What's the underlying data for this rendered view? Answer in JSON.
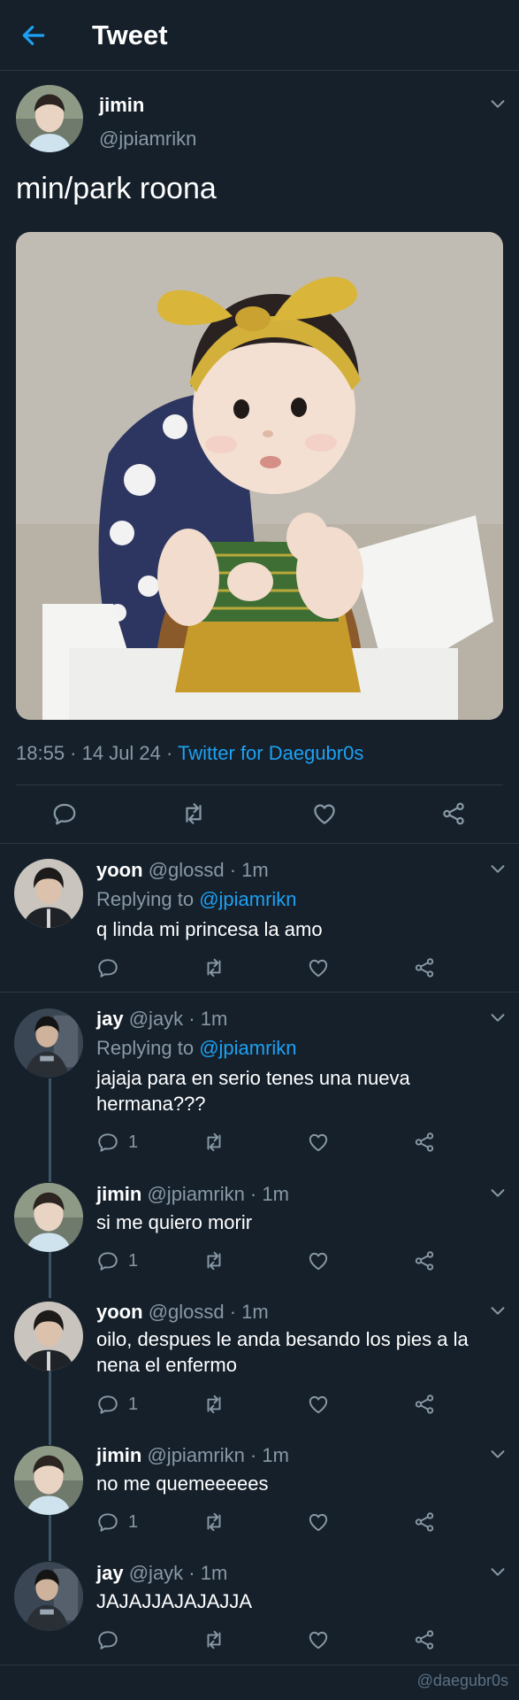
{
  "header": {
    "title": "Tweet"
  },
  "main": {
    "name": "jimin",
    "handle": "@jpiamrikn",
    "text": "min/park roona",
    "time": "18:55 · 14 Jul 24 · ",
    "source": "Twitter for Daegubr0s"
  },
  "replies": [
    {
      "name": "yoon",
      "meta": "@glossd · 1m",
      "replying_label": "Replying to ",
      "replying_to": "@jpiamrikn",
      "text": "q linda mi princesa la amo",
      "reply_count": ""
    },
    {
      "name": "jay",
      "meta": "@jayk · 1m",
      "replying_label": "Replying to ",
      "replying_to": "@jpiamrikn",
      "text": "jajaja para en serio tenes una nueva hermana???",
      "reply_count": "1"
    },
    {
      "name": "jimin",
      "meta": "@jpiamrikn · 1m",
      "text": "si me quiero morir",
      "reply_count": "1"
    },
    {
      "name": "yoon",
      "meta": "@glossd · 1m",
      "text": "oilo, despues le anda besando los pies a la nena el enfermo",
      "reply_count": "1"
    },
    {
      "name": "jimin",
      "meta": "@jpiamrikn · 1m",
      "text": "no me quemeeeees",
      "reply_count": "1"
    },
    {
      "name": "jay",
      "meta": "@jayk · 1m",
      "text": "JAJAJJAJAJAJJA",
      "reply_count": ""
    }
  ],
  "watermark": "@daegubr0s",
  "icons": [
    "back-arrow-icon",
    "chevron-down-icon",
    "reply-icon",
    "retweet-icon",
    "like-icon",
    "share-icon"
  ],
  "colors": {
    "background": "#15202b",
    "accent": "#1da1f2",
    "muted": "#8899a6",
    "divider": "#2a3744"
  }
}
